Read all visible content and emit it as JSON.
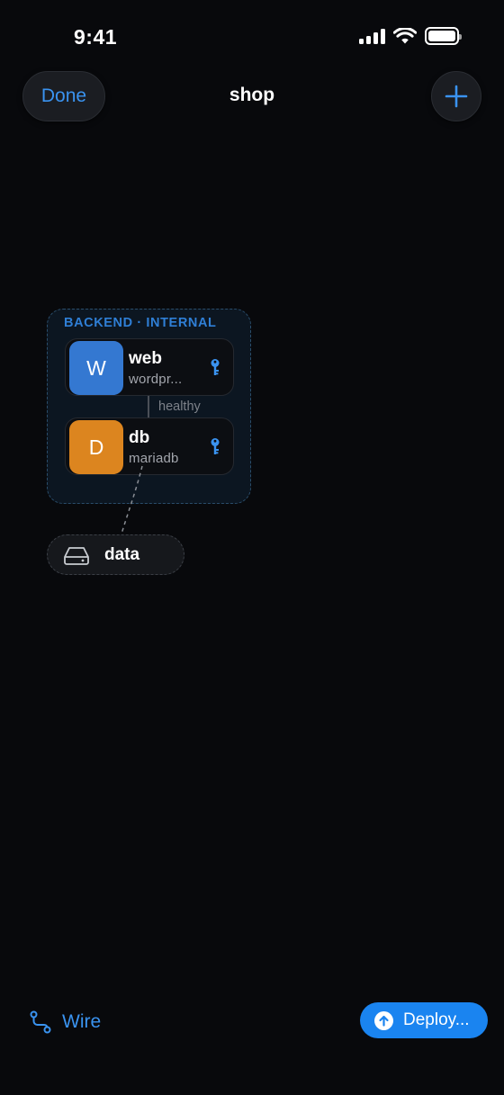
{
  "status_bar": {
    "time": "9:41"
  },
  "nav": {
    "done_label": "Done",
    "title": "shop",
    "add_icon": "plus-icon"
  },
  "canvas": {
    "group": {
      "label": "BACKEND · INTERNAL",
      "services": [
        {
          "initial": "W",
          "name": "web",
          "image": "wordpr...",
          "color": "#3478d1",
          "icon": "key-icon"
        },
        {
          "initial": "D",
          "name": "db",
          "image": "mariadb",
          "color": "#dc851f",
          "icon": "key-icon"
        }
      ],
      "link_label": "healthy"
    },
    "volume": {
      "name": "data",
      "icon": "drive-icon"
    }
  },
  "toolbar": {
    "wire_label": "Wire",
    "wire_icon": "connector-icon",
    "deploy_label": "Deploy...",
    "deploy_icon": "arrow-up-circle-icon"
  },
  "colors": {
    "accent": "#3a93f0",
    "deploy_bg": "#1a84f0",
    "group_label": "#2f7fd6",
    "background": "#08090c"
  }
}
